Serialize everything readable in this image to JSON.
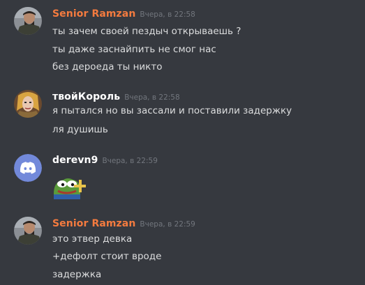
{
  "messages": [
    {
      "author": "Senior Ramzan",
      "author_color": "#f47b3f",
      "time": "Вчера, в 22:58",
      "avatar_icon": "ramzan-avatar-icon",
      "lines": [
        "ты зачем своей пездыч открываешь ?",
        "ты даже заснайпить не смог нас",
        "без дероеда ты никто"
      ]
    },
    {
      "author": "твойКороль",
      "author_color": "#ffffff",
      "time": "Вчера, в 22:58",
      "avatar_icon": "king-avatar-icon",
      "lines": [
        "я пытался но вы зассали и поставили задержку",
        "ля душишь"
      ]
    },
    {
      "author": "derevn9",
      "author_color": "#ffffff",
      "time": "Вчера, в 22:59",
      "avatar_icon": "discord-default-avatar-icon",
      "emoji": "pepe-plus-emoji-icon"
    },
    {
      "author": "Senior Ramzan",
      "author_color": "#f47b3f",
      "time": "Вчера, в 22:59",
      "avatar_icon": "ramzan-avatar-icon",
      "lines": [
        "это этвер девка",
        "+дефолт стоит вроде",
        "задержка"
      ]
    }
  ]
}
